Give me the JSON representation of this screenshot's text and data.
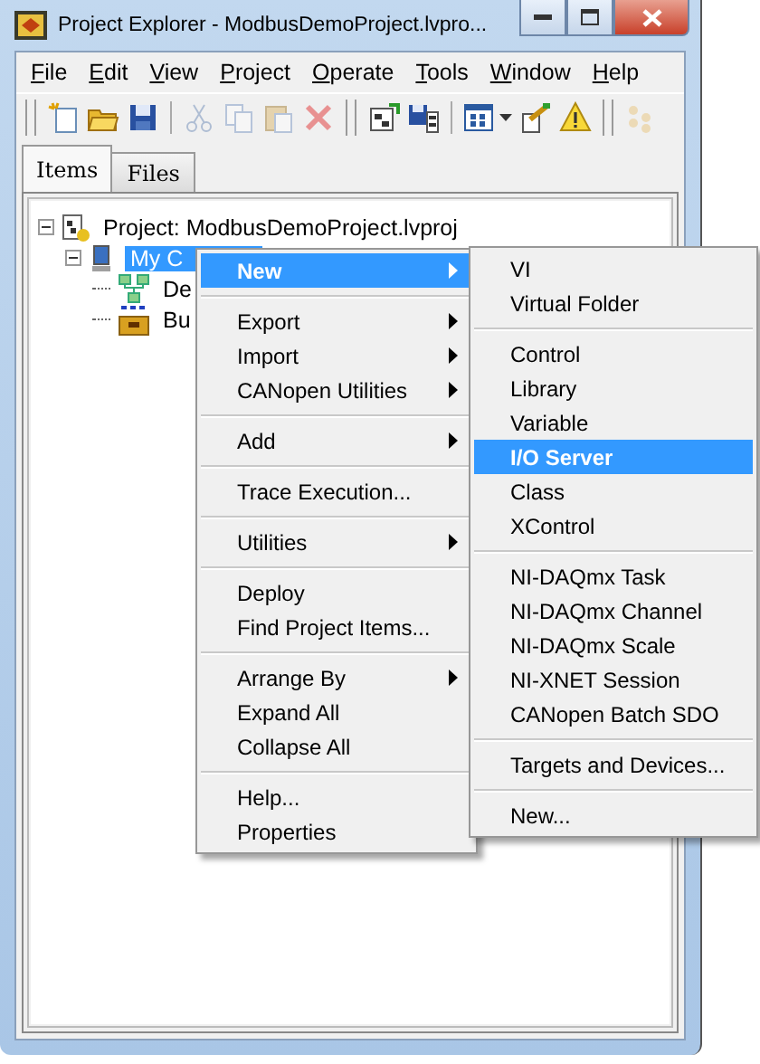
{
  "window": {
    "title": "Project Explorer - ModbusDemoProject.lvpro..."
  },
  "menu_bar": [
    {
      "label": "File"
    },
    {
      "label": "Edit"
    },
    {
      "label": "View"
    },
    {
      "label": "Project"
    },
    {
      "label": "Operate"
    },
    {
      "label": "Tools"
    },
    {
      "label": "Window"
    },
    {
      "label": "Help"
    }
  ],
  "toolbar": [
    {
      "kind": "grip"
    },
    {
      "kind": "new",
      "disabled": false
    },
    {
      "kind": "open",
      "disabled": false
    },
    {
      "kind": "save",
      "disabled": false
    },
    {
      "kind": "sep"
    },
    {
      "kind": "cut",
      "disabled": true
    },
    {
      "kind": "copy",
      "disabled": true
    },
    {
      "kind": "paste",
      "disabled": true
    },
    {
      "kind": "delete",
      "disabled": true
    },
    {
      "kind": "grip"
    },
    {
      "kind": "build",
      "disabled": false
    },
    {
      "kind": "saveall",
      "disabled": false
    },
    {
      "kind": "sep"
    },
    {
      "kind": "view",
      "disabled": false
    },
    {
      "kind": "dropdown",
      "disabled": false
    },
    {
      "kind": "wizard",
      "disabled": false
    },
    {
      "kind": "warning",
      "disabled": false
    },
    {
      "kind": "grip"
    },
    {
      "kind": "more",
      "disabled": true
    }
  ],
  "tabs": [
    {
      "label": "Items",
      "selected": true
    },
    {
      "label": "Files",
      "selected": false
    }
  ],
  "tree": [
    {
      "kind": "project",
      "label": "Project: ModbusDemoProject.lvproj",
      "expanded": true,
      "selected": false,
      "children": [
        {
          "kind": "computer",
          "label": "My C",
          "expanded": true,
          "selected": true,
          "children": [
            {
              "kind": "dependencies",
              "label": "De",
              "selected": false
            },
            {
              "kind": "build",
              "label": "Bu",
              "selected": false
            }
          ]
        }
      ]
    }
  ],
  "context_menu": {
    "items": [
      {
        "kind": "item",
        "label": "New",
        "submenu": true,
        "selected": true
      },
      {
        "kind": "separator"
      },
      {
        "kind": "item",
        "label": "Export",
        "submenu": true,
        "selected": false
      },
      {
        "kind": "item",
        "label": "Import",
        "submenu": true,
        "selected": false
      },
      {
        "kind": "item",
        "label": "CANopen Utilities",
        "submenu": true,
        "selected": false
      },
      {
        "kind": "separator"
      },
      {
        "kind": "item",
        "label": "Add",
        "submenu": true,
        "selected": false
      },
      {
        "kind": "separator"
      },
      {
        "kind": "item",
        "label": "Trace Execution...",
        "submenu": false,
        "selected": false
      },
      {
        "kind": "separator"
      },
      {
        "kind": "item",
        "label": "Utilities",
        "submenu": true,
        "selected": false
      },
      {
        "kind": "separator"
      },
      {
        "kind": "item",
        "label": "Deploy",
        "submenu": false,
        "selected": false
      },
      {
        "kind": "item",
        "label": "Find Project Items...",
        "submenu": false,
        "selected": false
      },
      {
        "kind": "separator"
      },
      {
        "kind": "item",
        "label": "Arrange By",
        "submenu": true,
        "selected": false
      },
      {
        "kind": "item",
        "label": "Expand All",
        "submenu": false,
        "selected": false
      },
      {
        "kind": "item",
        "label": "Collapse All",
        "submenu": false,
        "selected": false
      },
      {
        "kind": "separator"
      },
      {
        "kind": "item",
        "label": "Help...",
        "submenu": false,
        "selected": false
      },
      {
        "kind": "item",
        "label": "Properties",
        "submenu": false,
        "selected": false
      }
    ]
  },
  "submenu": {
    "items": [
      {
        "kind": "item",
        "label": "VI",
        "selected": false
      },
      {
        "kind": "item",
        "label": "Virtual Folder",
        "selected": false
      },
      {
        "kind": "separator"
      },
      {
        "kind": "item",
        "label": "Control",
        "selected": false
      },
      {
        "kind": "item",
        "label": "Library",
        "selected": false
      },
      {
        "kind": "item",
        "label": "Variable",
        "selected": false
      },
      {
        "kind": "item",
        "label": "I/O Server",
        "selected": true
      },
      {
        "kind": "item",
        "label": "Class",
        "selected": false
      },
      {
        "kind": "item",
        "label": "XControl",
        "selected": false
      },
      {
        "kind": "separator"
      },
      {
        "kind": "item",
        "label": "NI-DAQmx Task",
        "selected": false
      },
      {
        "kind": "item",
        "label": "NI-DAQmx Channel",
        "selected": false
      },
      {
        "kind": "item",
        "label": "NI-DAQmx Scale",
        "selected": false
      },
      {
        "kind": "item",
        "label": "NI-XNET Session",
        "selected": false
      },
      {
        "kind": "item",
        "label": "CANopen Batch SDO",
        "selected": false
      },
      {
        "kind": "separator"
      },
      {
        "kind": "item",
        "label": "Targets and Devices...",
        "selected": false
      },
      {
        "kind": "separator"
      },
      {
        "kind": "item",
        "label": "New...",
        "selected": false
      }
    ]
  }
}
